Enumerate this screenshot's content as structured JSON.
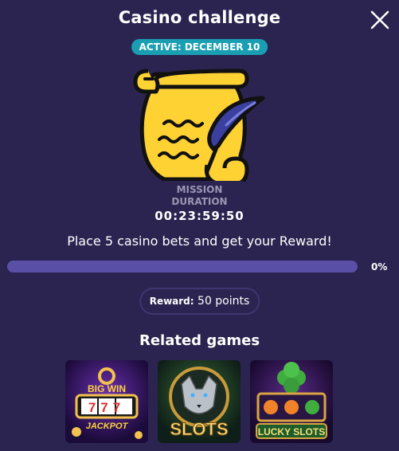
{
  "header": {
    "title": "Casino challenge",
    "badge": "ACTIVE: DECEMBER 10"
  },
  "icons": {
    "close": "close-icon",
    "hero": "scroll-quill-icon"
  },
  "timer": {
    "label_line1": "MISSION",
    "label_line2": "DURATION",
    "value": "00:23:59:50"
  },
  "mission": {
    "text": "Place 5 casino bets and get your Reward!",
    "progress_percent": 0,
    "progress_label": "0%"
  },
  "reward": {
    "label": "Reward:",
    "value": "50 points"
  },
  "related": {
    "title": "Related games",
    "games": [
      {
        "name": "BIG WIN 777 JACKPOT",
        "line1": "BIG WIN",
        "line2": "777",
        "line3": "JACKPOT"
      },
      {
        "name": "SLOTS",
        "line1": "SLOTS"
      },
      {
        "name": "LUCKY SLOTS",
        "line1": "LUCKY SLOTS"
      }
    ]
  },
  "colors": {
    "background": "#2b2450",
    "badge": "#1a9fb2",
    "progress_track": "#5a4fa6",
    "scroll": "#ffd233"
  }
}
